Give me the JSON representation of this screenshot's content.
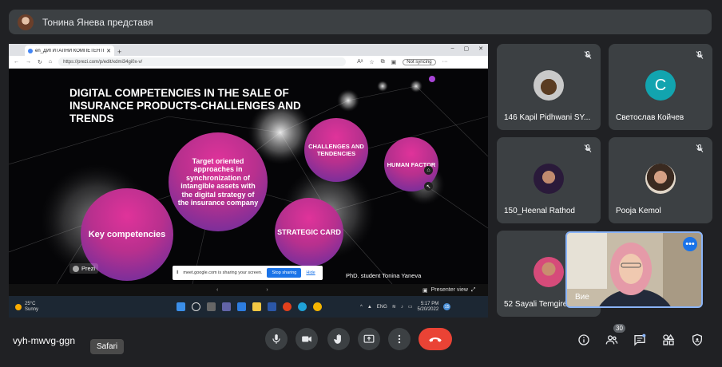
{
  "banner": {
    "presenter_text": "Тонина Янева представя"
  },
  "browser": {
    "tab_title": "en_ДИГИТАЛНИ КОМПЕТЕНТН",
    "url": "https://prezi.com/p/edit/xdmi34gi0x-v/",
    "not_syncing": "Not syncing"
  },
  "slide": {
    "title": "DIGITAL COMPETENCIES IN THE SALE OF INSURANCE PRODUCTS-CHALLENGES AND TRENDS",
    "circle_target": "Target oriented approaches in synchronization of intangible assets with the digital strategy of the insurance company",
    "circle_challenges": "CHALLENGES AND TENDENCIES",
    "circle_human": "HUMAN FACTOR",
    "circle_key": "Key competencies",
    "circle_strategic": "STRATEGIC CARD",
    "prezi_logo": "Prezi",
    "phd_label": "PhD. student Tonina Yaneva"
  },
  "share_notice": {
    "text": "meet.google.com is sharing your screen.",
    "stop_label": "Stop sharing",
    "hide_label": "Hide"
  },
  "prezi_controls": {
    "presenter_view": "Presenter view"
  },
  "taskbar": {
    "temp": "25°C",
    "weather": "Sunny",
    "lang": "ENG",
    "time": "5:17 PM",
    "date": "5/20/2022",
    "notif_count": "15"
  },
  "participants": [
    {
      "name": "146 Kapil Pidhwani SY..."
    },
    {
      "name": "Светослав Койчев",
      "initial": "C"
    },
    {
      "name": "150_Heenal Rathod"
    },
    {
      "name": "Pooja Kemol"
    },
    {
      "name": "52 Sayali Temgire"
    }
  ],
  "self": {
    "name": "Вие"
  },
  "meeting": {
    "code": "vyh-mwvg-ggn",
    "tooltip": "Safari",
    "people_count": "30"
  },
  "colors": {
    "accent": "#8ab4f8",
    "end_call": "#ea4335",
    "tile_bg": "#3c4043",
    "page_bg": "#202124"
  }
}
